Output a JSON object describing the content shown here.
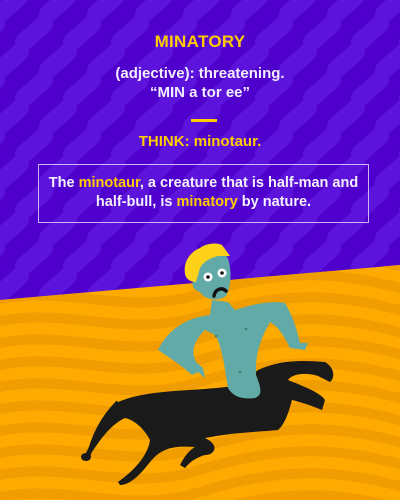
{
  "card": {
    "word": "MINATORY",
    "definition": "(adjective): threatening.",
    "pronunciation": "“MIN a tor ee”",
    "mnemonic": "THINK: minotaur.",
    "sentence": {
      "part1": "The ",
      "highlight1": "minotaur",
      "part2": ", a creature that is half-man and half-bull, is ",
      "highlight2": "minatory",
      "part3": " by nature."
    }
  },
  "colors": {
    "background_top": "#5000cc",
    "background_bottom": "#ffaa00",
    "accent": "#ffcc00",
    "skin": "#62aaa8",
    "bull_body": "#1a1a1a"
  }
}
